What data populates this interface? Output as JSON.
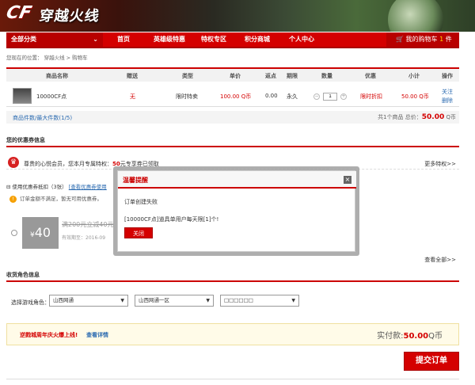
{
  "banner": {
    "logo": "CF",
    "title": "穿越火线"
  },
  "nav": {
    "category": "全部分类",
    "items": [
      "首页",
      "英雄级特惠",
      "特权专区",
      "积分商城",
      "个人中心"
    ],
    "cart": "我的购物车",
    "cart_count": "1",
    "cart_unit": "件"
  },
  "breadcrumb": {
    "prefix": "您现在的位置：",
    "trail": "穿越火线 > 购物车"
  },
  "cart": {
    "headers": [
      "商品名称",
      "赠送",
      "类型",
      "单价",
      "返点",
      "期限",
      "数量",
      "优惠",
      "小计",
      "操作"
    ],
    "row": {
      "name": "10000CF点",
      "gift": "无",
      "type": "限时特卖",
      "price": "100.00 Q币",
      "rebate": "0.00",
      "term": "永久",
      "qty": "1",
      "discount": "限时折扣",
      "subtotal": "50.00 Q币",
      "op1": "关注",
      "op2": "删除"
    },
    "summary_left": "商品件数/最大件数(1/5)",
    "summary_right_prefix": "共1个商品 总价：",
    "summary_total": "50.00",
    "summary_unit": "Q币"
  },
  "coupons": {
    "title": "您的优惠券信息",
    "member_text_a": "尊贵的心悦会员，您本月专属特权：",
    "member_amount": "50",
    "member_text_b": "元专享券已领取",
    "more": "更多特权>>",
    "use_label": "使用优惠券抵扣（3张）",
    "use_link": "[查看优惠券使用",
    "warn": "订单金额不满足，暂无可用优惠券。",
    "card_value": "40",
    "card_symbol": "¥",
    "card_title": "满200元立减40元",
    "card_valid": "有效期至：2016-09",
    "view_all": "查看全部>>"
  },
  "role": {
    "title": "收货角色信息",
    "label": "选择游戏角色：",
    "sel1": "山西网通",
    "sel2": "山西网通一区",
    "sel3": "□□□□□□"
  },
  "promo": {
    "a": "逆戮城周年庆火爆上线!",
    "b": "查看详情",
    "paid_label": "实付款:",
    "paid_amount": "50.00",
    "paid_unit": "Q币"
  },
  "submit": "提交订单",
  "modal": {
    "title": "温馨提醒",
    "close": "×",
    "msg1": "订单创建失败",
    "msg2": "[10000CF点]道具单用户每天限[1]个!",
    "button": "关闭"
  }
}
